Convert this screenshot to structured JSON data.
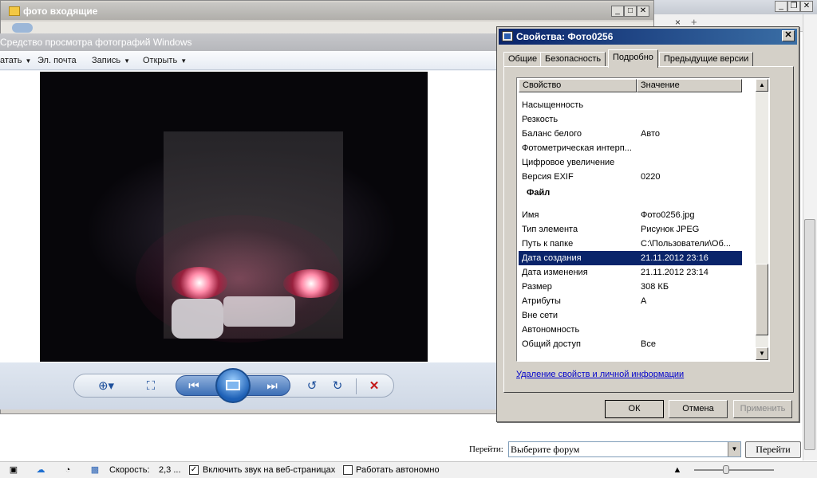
{
  "explorer": {
    "title": "фото входящие"
  },
  "viewer": {
    "title": "Средство просмотра фотографий Windows",
    "menu": [
      {
        "label": "атать"
      },
      {
        "label": "Эл. почта"
      },
      {
        "label": "Запись"
      },
      {
        "label": "Открыть"
      }
    ]
  },
  "dialog": {
    "title": "Свойства: Фото0256",
    "tabs": [
      "Общие",
      "Безопасность",
      "Подробно",
      "Предыдущие версии"
    ],
    "active_tab": "Подробно",
    "columns": [
      "Свойство",
      "Значение"
    ],
    "rows": [
      {
        "name": "Насыщенность",
        "value": ""
      },
      {
        "name": "Резкость",
        "value": ""
      },
      {
        "name": "Баланс белого",
        "value": "Авто"
      },
      {
        "name": "Фотометрическая интерп...",
        "value": ""
      },
      {
        "name": "Цифровое увеличение",
        "value": ""
      },
      {
        "name": "Версия EXIF",
        "value": "0220"
      }
    ],
    "group_file": "Файл",
    "file_rows": [
      {
        "name": "Имя",
        "value": "Фото0256.jpg"
      },
      {
        "name": "Тип элемента",
        "value": "Рисунок JPEG"
      },
      {
        "name": "Путь к папке",
        "value": "C:\\Пользователи\\Об..."
      },
      {
        "name": "Дата создания",
        "value": "21.11.2012 23:16"
      },
      {
        "name": "Дата изменения",
        "value": "21.11.2012 23:14"
      },
      {
        "name": "Размер",
        "value": "308 КБ"
      },
      {
        "name": "Атрибуты",
        "value": "A"
      },
      {
        "name": "Вне сети",
        "value": ""
      },
      {
        "name": "Автономность",
        "value": ""
      },
      {
        "name": "Общий доступ",
        "value": "Все"
      }
    ],
    "selected_row": "Дата создания",
    "link": "Удаление свойств и личной информации",
    "buttons": {
      "ok": "ОК",
      "cancel": "Отмена",
      "apply": "Применить"
    }
  },
  "forum": {
    "label": "Перейти:",
    "select_value": "Выберите форум",
    "go": "Перейти"
  },
  "statusbar": {
    "speed_label": "Скорость:",
    "speed_value": "2,3 ...",
    "sound_label": "Включить звук на веб-страницах",
    "sound_checked": true,
    "offline_label": "Работать автономно",
    "offline_checked": false
  }
}
